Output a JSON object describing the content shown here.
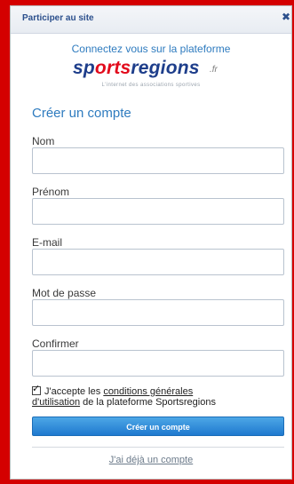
{
  "dialog": {
    "title": "Participer au site",
    "close_icon": "close-icon"
  },
  "brand": {
    "connect_text": "Connectez vous sur la plateforme",
    "logo_text_part1": "sp",
    "logo_text_part2": "orts",
    "logo_text_part3": "regions",
    "logo_suffix": ".fr",
    "tagline": "L'internet des associations sportives",
    "colors": {
      "blue": "#1e3e8b",
      "red": "#e20b1c",
      "link_blue": "#2e7bbf"
    }
  },
  "form": {
    "heading": "Créer un compte",
    "fields": [
      {
        "label": "Nom",
        "value": ""
      },
      {
        "label": "Prénom",
        "value": ""
      },
      {
        "label": "E-mail",
        "value": ""
      },
      {
        "label": "Mot de passe",
        "value": ""
      },
      {
        "label": "Confirmer",
        "value": ""
      }
    ],
    "accept": {
      "checked": true,
      "prefix": "J'accepte les ",
      "link1": "conditions générales",
      "link2": "d'utilisation",
      "suffix": " de la plateforme Sportsregions"
    },
    "submit_label": "Créer un compte",
    "already_account": "J'ai déjà un compte"
  }
}
